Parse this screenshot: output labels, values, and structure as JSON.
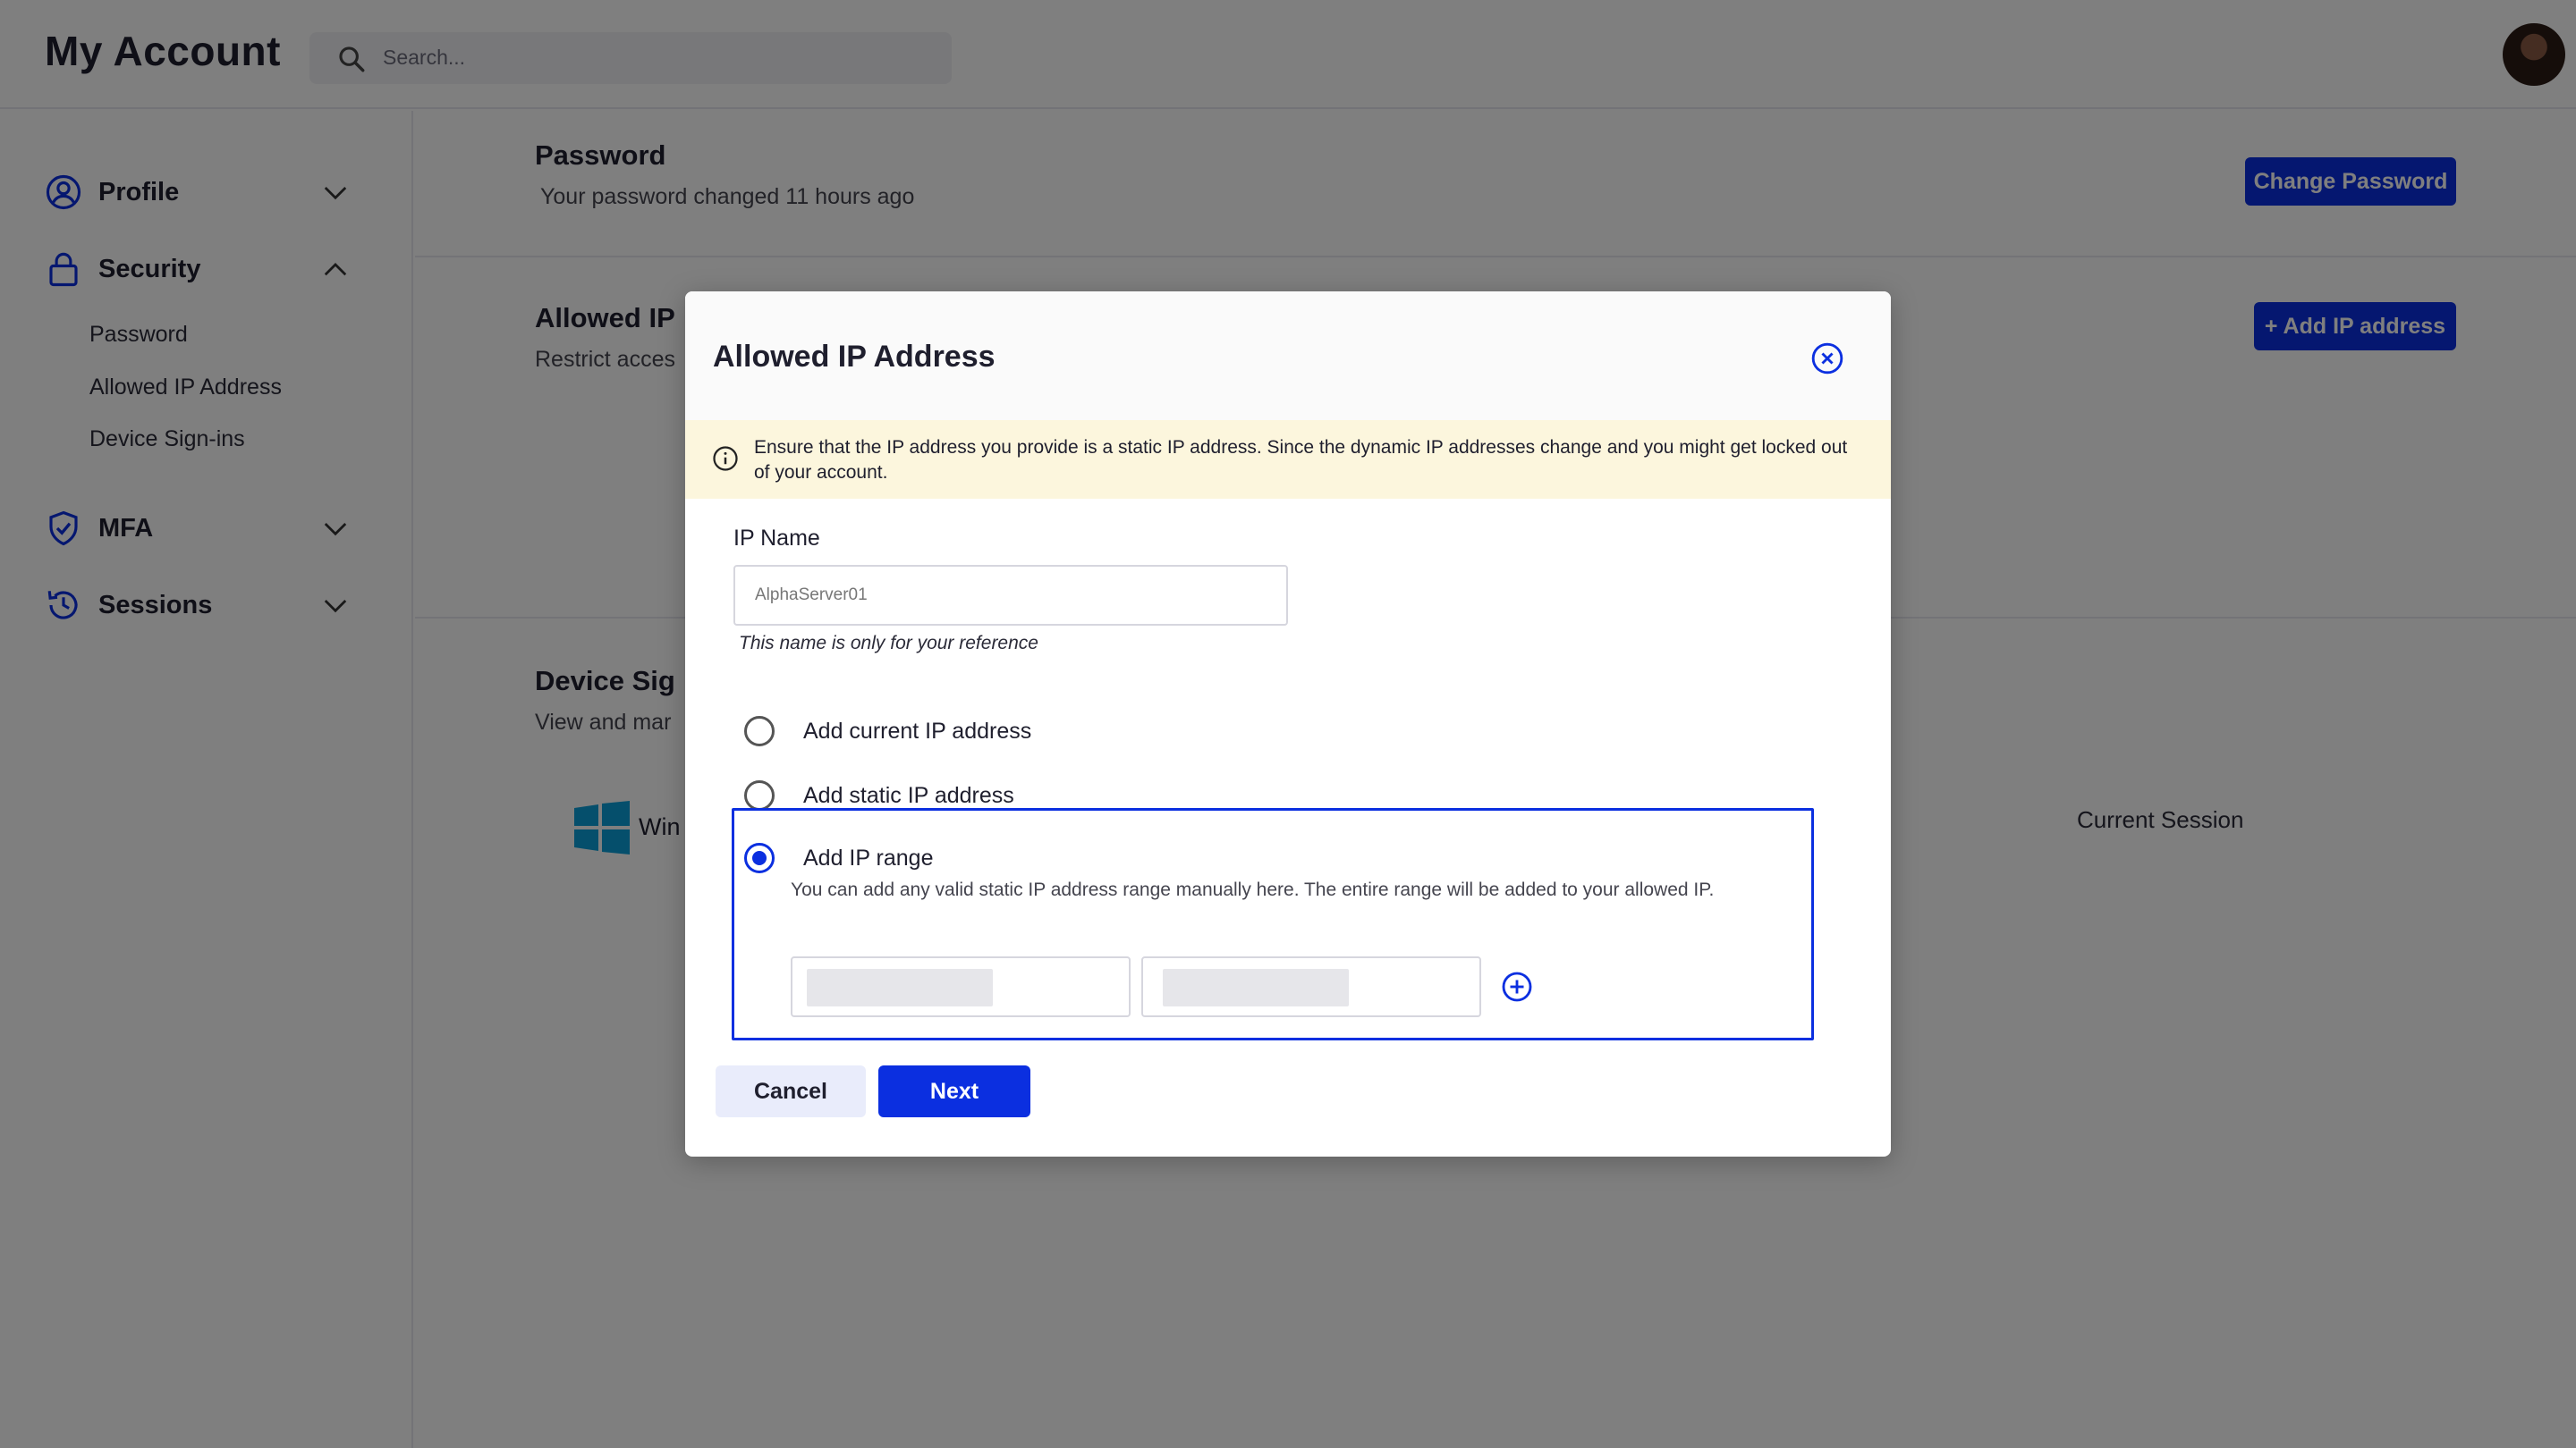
{
  "app": {
    "title": "My Account",
    "search_placeholder": "Search..."
  },
  "sidebar": {
    "items": [
      {
        "label": "Profile",
        "icon": "user-circle-icon",
        "expanded": false
      },
      {
        "label": "Security",
        "icon": "lock-icon",
        "expanded": true,
        "subitems": [
          "Password",
          "Allowed IP Address",
          "Device Sign-ins"
        ]
      },
      {
        "label": "MFA",
        "icon": "shield-check-icon",
        "expanded": false
      },
      {
        "label": "Sessions",
        "icon": "history-icon",
        "expanded": false
      }
    ]
  },
  "main": {
    "password": {
      "title": "Password",
      "subtitle": "Your password changed 11 hours ago",
      "button": "Change Password"
    },
    "allowed_ip": {
      "title": "Allowed IP",
      "subtitle": "Restrict acces",
      "button": "+ Add IP address"
    },
    "device_signins": {
      "title": "Device Sig",
      "subtitle": "View and mar",
      "device_text": "Win",
      "current_session": "Current Session"
    }
  },
  "modal": {
    "title": "Allowed IP Address",
    "notice": "Ensure that the IP address you provide is a static IP address. Since the dynamic IP addresses change and you might get locked out of your account.",
    "ip_name_label": "IP Name",
    "ip_name_placeholder": "AlphaServer01",
    "ip_name_hint": "This name is only for your reference",
    "options": [
      {
        "label": "Add current IP address",
        "selected": false
      },
      {
        "label": "Add static IP address",
        "selected": false
      },
      {
        "label": "Add IP range",
        "selected": true
      }
    ],
    "range_description": "You can add any valid static IP address range manually here. The entire range will be added to your allowed IP.",
    "range_start_value": "",
    "range_end_value": "",
    "cancel_label": "Cancel",
    "next_label": "Next"
  },
  "colors": {
    "primary": "#0b2fe0",
    "notice_bg": "#fcf6dd",
    "overlay": "rgba(0,0,0,0.5)"
  }
}
